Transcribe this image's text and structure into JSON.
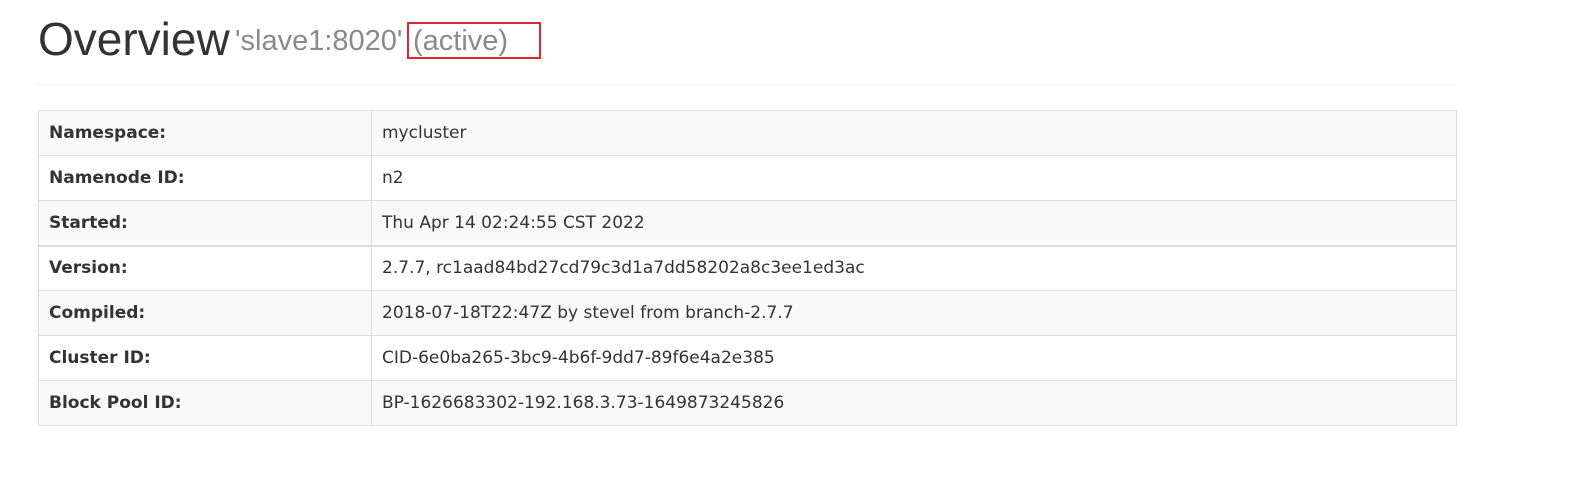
{
  "header": {
    "title": "Overview",
    "host": "'slave1:8020'",
    "state": "(active)"
  },
  "info_rows": [
    {
      "key": "Namespace:",
      "value": "mycluster"
    },
    {
      "key": "Namenode ID:",
      "value": "n2"
    },
    {
      "key": "Started:",
      "value": "Thu Apr 14 02:24:55 CST 2022"
    },
    {
      "key": "Version:",
      "value": "2.7.7, rc1aad84bd27cd79c3d1a7dd58202a8c3ee1ed3ac"
    },
    {
      "key": "Compiled:",
      "value": "2018-07-18T22:47Z by stevel from branch-2.7.7"
    },
    {
      "key": "Cluster ID:",
      "value": "CID-6e0ba265-3bc9-4b6f-9dd7-89f6e4a2e385"
    },
    {
      "key": "Block Pool ID:",
      "value": "BP-1626683302-192.168.3.73-1649873245826"
    }
  ],
  "colors": {
    "highlight_border": "#e0262e",
    "subtitle_text": "#8a8a8a",
    "striped_row": "#f9f9f9",
    "table_border": "#dddddd"
  }
}
